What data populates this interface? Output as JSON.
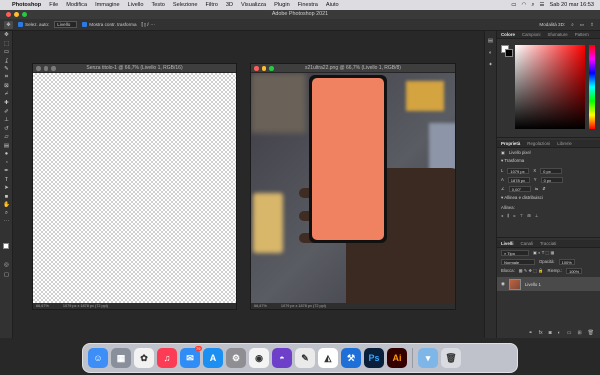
{
  "menubar": {
    "app_name": "Photoshop",
    "items": [
      "File",
      "Modifica",
      "Immagine",
      "Livello",
      "Testo",
      "Selezione",
      "Filtro",
      "3D",
      "Visualizza",
      "Plugin",
      "Finestra",
      "Aiuto"
    ],
    "clock": "Sab 20 mar  16:53"
  },
  "window": {
    "title": "Adobe Photoshop 2021"
  },
  "options_bar": {
    "auto_select_label": "Selez. auto:",
    "auto_select_value": "Livello",
    "show_transform_label": "Mostra contr. trasforma",
    "mode_3d_label": "Modalità 3D:"
  },
  "doc1": {
    "title": "Senza titolo-1 @ 66,7% (Livello 1, RGB/16)",
    "zoom": "66,67%",
    "info": "1079 px x 1878 px (72 ppi)"
  },
  "doc2": {
    "title": "s21ultra22.png @ 66,7% (Livello 1, RGB/8)",
    "zoom": "66,67%",
    "info": "1079 px x 1878 px (72 ppi)",
    "screen_color": "#f08262"
  },
  "color_panel": {
    "tabs": [
      "Colore",
      "Campioni",
      "Sfumature",
      "Pattern"
    ],
    "active": "Colore"
  },
  "properties_panel": {
    "tabs": [
      "Proprietà",
      "Regolazioni",
      "Librerie"
    ],
    "active": "Proprietà",
    "layer_type": "Livello pixel",
    "transform_label": "Trasforma",
    "w": "1079 px",
    "h": "1878 px",
    "x": "0 px",
    "y": "0 px",
    "angle": "0,00°",
    "align_label": "Allinea e distribuisci",
    "align_sub": "Allinea:"
  },
  "layers_panel": {
    "tabs": [
      "Livelli",
      "Canali",
      "Tracciati"
    ],
    "active": "Livelli",
    "kind": "Tipo",
    "blend_mode": "Normale",
    "opacity_label": "Opacità:",
    "opacity": "100%",
    "lock_label": "Blocca:",
    "fill_label": "Riemp.:",
    "fill": "100%",
    "layers": [
      {
        "name": "Livello 1",
        "visible": true
      }
    ]
  },
  "dock": {
    "apps": [
      {
        "name": "Finder",
        "glyph": "☺",
        "color": "#3d8ef7"
      },
      {
        "name": "Launchpad",
        "glyph": "▦",
        "color": "#8a8f9c"
      },
      {
        "name": "Foto",
        "glyph": "✿",
        "color": "#f2f2f2"
      },
      {
        "name": "Musica",
        "glyph": "♫",
        "color": "#fb3c54"
      },
      {
        "name": "Mail",
        "glyph": "✉",
        "color": "#2f8df5",
        "badge": "79"
      },
      {
        "name": "App Store",
        "glyph": "A",
        "color": "#1c8ff2"
      },
      {
        "name": "Preferenze di Sistema",
        "glyph": "⚙",
        "color": "#8e8e93"
      },
      {
        "name": "Chrome",
        "glyph": "◉",
        "color": "#f4f4f4"
      },
      {
        "name": "GitHub Desktop",
        "glyph": "◓",
        "color": "#6e40c9"
      },
      {
        "name": "Affinity",
        "glyph": "✎",
        "color": "#eaeaea"
      },
      {
        "name": "Prisma",
        "glyph": "◭",
        "color": "#ffffff"
      },
      {
        "name": "Xcode",
        "glyph": "⚒",
        "color": "#1f6fd8"
      },
      {
        "name": "Photoshop",
        "glyph": "Ps",
        "color": "#0a1f3a"
      },
      {
        "name": "Illustrator",
        "glyph": "Ai",
        "color": "#330000"
      }
    ],
    "trailing": [
      {
        "name": "Downloads",
        "glyph": "▾",
        "color": "#7fb6e8"
      },
      {
        "name": "Cestino",
        "glyph": "🗑",
        "color": "#d9dbe0"
      }
    ]
  }
}
